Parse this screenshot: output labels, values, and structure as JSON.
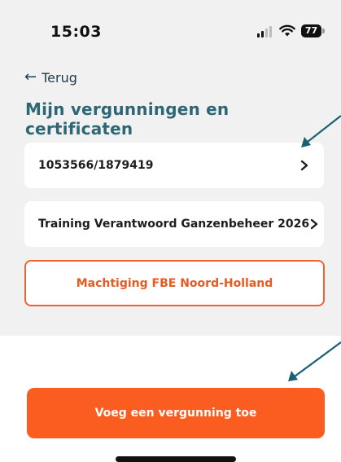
{
  "status_bar": {
    "time": "15:03",
    "battery": "77"
  },
  "header": {
    "back_label": "Terug",
    "title": "Mijn vergunningen en certificaten"
  },
  "list": {
    "items": [
      {
        "label": "1053566/1879419"
      },
      {
        "label": "Training Verantwoord Ganzenbeheer 2026"
      }
    ]
  },
  "actions": {
    "machtiging_label": "Machtiging FBE Noord-Holland",
    "add_label": "Voeg een vergunning toe"
  },
  "colors": {
    "accent": "#fa5d1f",
    "title": "#2d6675",
    "annotation_arrow": "#1b5f73"
  },
  "icons": [
    "back-arrow-icon",
    "chevron-right-icon",
    "signal-icon",
    "wifi-icon",
    "battery-icon"
  ]
}
